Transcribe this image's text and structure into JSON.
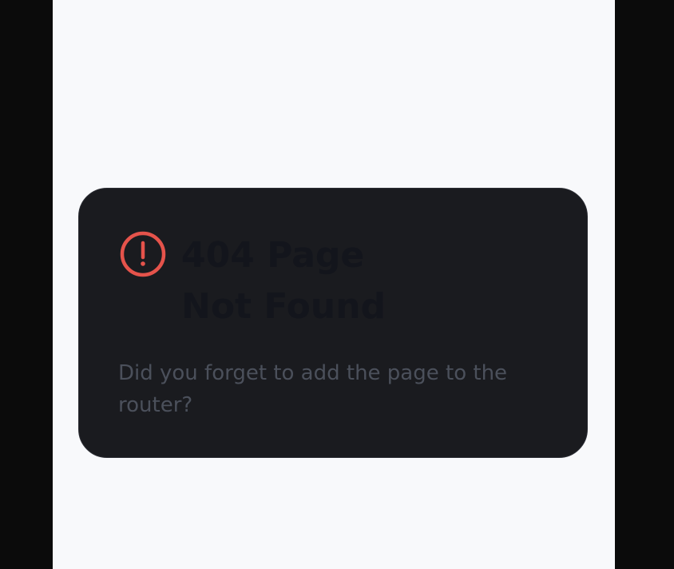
{
  "error_card": {
    "icon": "alert-circle-icon",
    "title": "404 Page Not Found",
    "message": "Did you forget to add the page to the router?"
  },
  "colors": {
    "page_background": "#f8f9fb",
    "outer_background": "#0b0b0b",
    "card_background": "#1a1b1f",
    "icon": "#e5534b",
    "title": "#13151c",
    "message": "#4b505b"
  }
}
